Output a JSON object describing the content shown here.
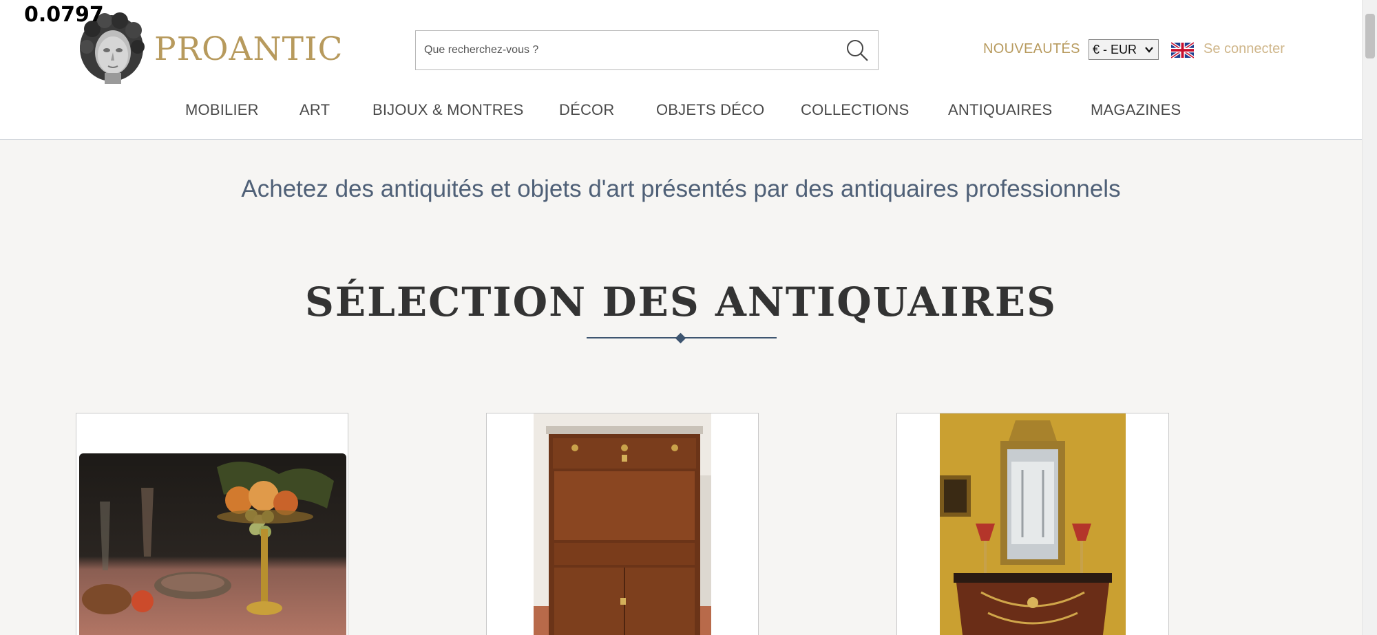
{
  "overlay": {
    "value": "0.0797"
  },
  "brand": {
    "name": "PROANTIC"
  },
  "search": {
    "placeholder": "Que recherchez-vous ?",
    "value": ""
  },
  "header": {
    "new_label": "NOUVEAUTÉS",
    "currency": "€ - EUR",
    "login_label": "Se connecter",
    "flag": "uk-flag-icon"
  },
  "nav": {
    "items": [
      {
        "label": "MOBILIER"
      },
      {
        "label": "ART"
      },
      {
        "label": "BIJOUX & MONTRES"
      },
      {
        "label": "DÉCOR"
      },
      {
        "label": "OBJETS DÉCO"
      },
      {
        "label": "COLLECTIONS"
      },
      {
        "label": "ANTIQUAIRES"
      },
      {
        "label": "MAGAZINES"
      }
    ]
  },
  "main": {
    "tagline": "Achetez des antiquités et objets d'art présentés par des antiquaires professionnels",
    "section_title": "SÉLECTION DES ANTIQUAIRES"
  },
  "colors": {
    "brand_gold": "#b79a5d",
    "navy": "#3e5570",
    "background": "#f6f5f3"
  }
}
